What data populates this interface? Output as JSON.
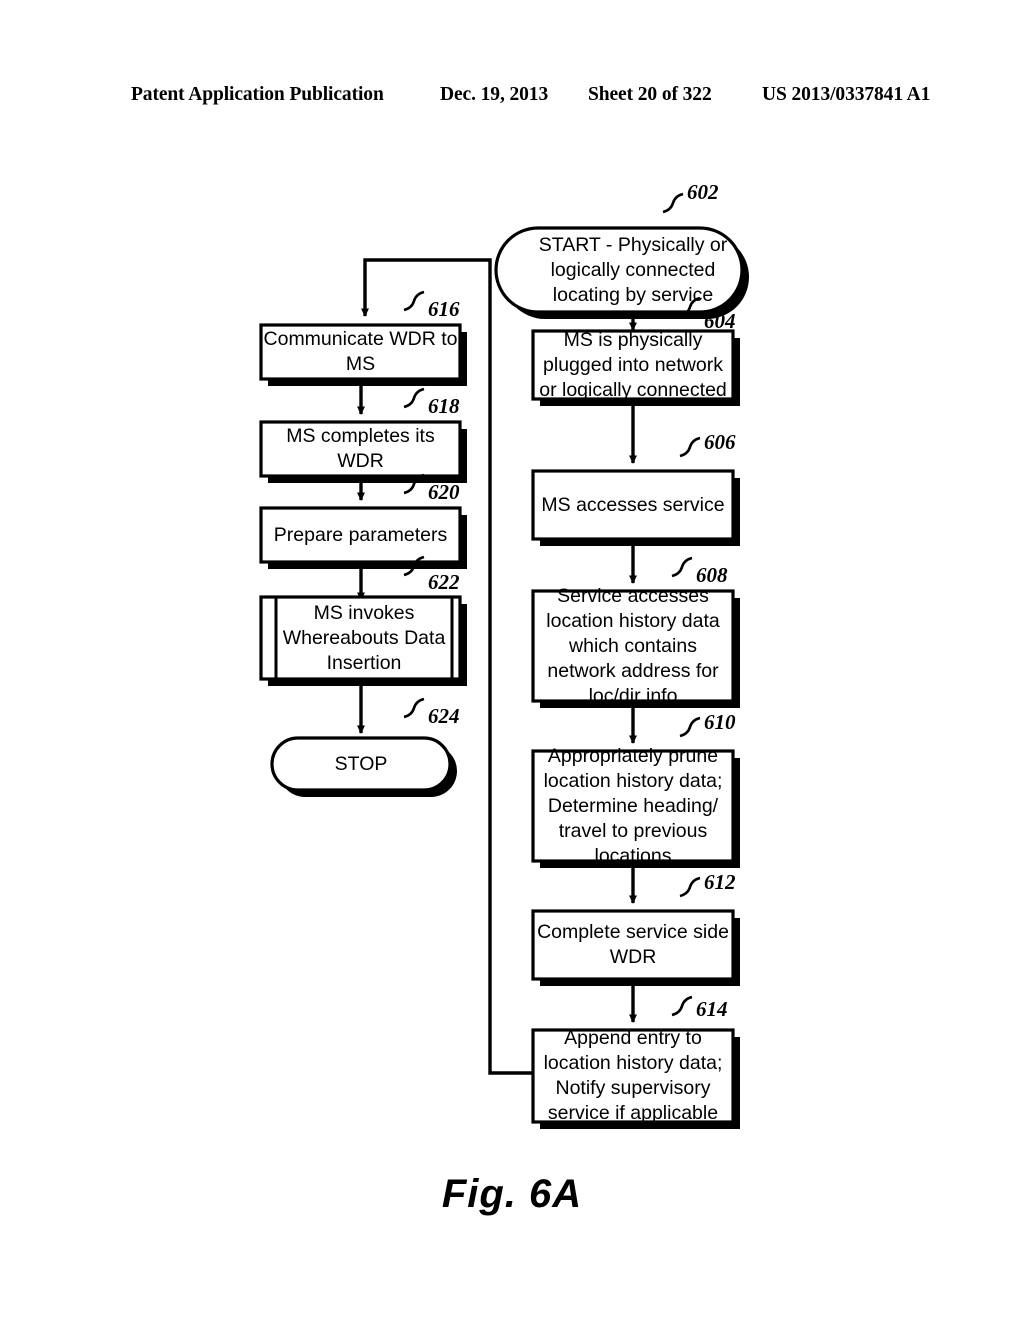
{
  "header": {
    "publication": "Patent Application Publication",
    "date": "Dec. 19, 2013",
    "sheet": "Sheet 20 of 322",
    "patent_number": "US 2013/0337841 A1"
  },
  "figure": {
    "caption": "Fig. 6A"
  },
  "flowchart": {
    "right_column": [
      {
        "ref": "602",
        "shape": "terminator",
        "text": "START - Physically or\nlogically connected\nlocating by service"
      },
      {
        "ref": "604",
        "shape": "process",
        "text": "MS is physically\nplugged into network\nor logically connected"
      },
      {
        "ref": "606",
        "shape": "process",
        "text": "MS accesses service"
      },
      {
        "ref": "608",
        "shape": "process",
        "text": "Service accesses\nlocation history data\nwhich contains\nnetwork address for\nloc/dir info"
      },
      {
        "ref": "610",
        "shape": "process",
        "text": "Appropriately prune\nlocation history data;\nDetermine heading/\ntravel to previous\nlocations"
      },
      {
        "ref": "612",
        "shape": "process",
        "text": "Complete service side\nWDR"
      },
      {
        "ref": "614",
        "shape": "process",
        "text": "Append entry to\nlocation history data;\nNotify supervisory\nservice if applicable"
      }
    ],
    "left_column": [
      {
        "ref": "616",
        "shape": "process",
        "text": "Communicate WDR to\nMS"
      },
      {
        "ref": "618",
        "shape": "process",
        "text": "MS completes its\nWDR"
      },
      {
        "ref": "620",
        "shape": "process",
        "text": "Prepare parameters"
      },
      {
        "ref": "622",
        "shape": "predefined-process",
        "text": "MS invokes\nWhereabouts Data\nInsertion"
      },
      {
        "ref": "624",
        "shape": "terminator",
        "text": "STOP"
      }
    ]
  },
  "colors": {
    "ink": "#000000",
    "paper": "#ffffff"
  }
}
